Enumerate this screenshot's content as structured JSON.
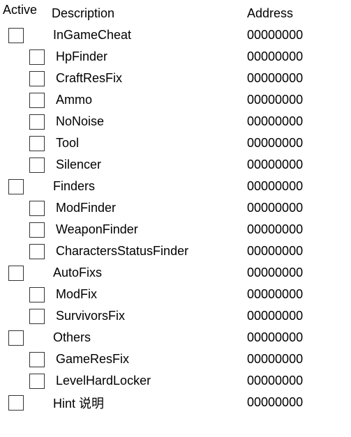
{
  "columns": {
    "active": "Active",
    "description": "Description",
    "address": "Address"
  },
  "rows": [
    {
      "indent": 0,
      "desc": "InGameCheat",
      "addr": "00000000",
      "checked": false
    },
    {
      "indent": 1,
      "desc": "HpFinder",
      "addr": "00000000",
      "checked": false
    },
    {
      "indent": 1,
      "desc": "CraftResFix",
      "addr": "00000000",
      "checked": false
    },
    {
      "indent": 1,
      "desc": "Ammo",
      "addr": "00000000",
      "checked": false
    },
    {
      "indent": 1,
      "desc": "NoNoise",
      "addr": "00000000",
      "checked": false
    },
    {
      "indent": 1,
      "desc": "Tool",
      "addr": "00000000",
      "checked": false
    },
    {
      "indent": 1,
      "desc": "Silencer",
      "addr": "00000000",
      "checked": false
    },
    {
      "indent": 0,
      "desc": "Finders",
      "addr": "00000000",
      "checked": false
    },
    {
      "indent": 1,
      "desc": "ModFinder",
      "addr": "00000000",
      "checked": false
    },
    {
      "indent": 1,
      "desc": "WeaponFinder",
      "addr": "00000000",
      "checked": false
    },
    {
      "indent": 1,
      "desc": "CharactersStatusFinder",
      "addr": "00000000",
      "checked": false
    },
    {
      "indent": 0,
      "desc": "AutoFixs",
      "addr": "00000000",
      "checked": false
    },
    {
      "indent": 1,
      "desc": "ModFix",
      "addr": "00000000",
      "checked": false
    },
    {
      "indent": 1,
      "desc": "SurvivorsFix",
      "addr": "00000000",
      "checked": false
    },
    {
      "indent": 0,
      "desc": "Others",
      "addr": "00000000",
      "checked": false
    },
    {
      "indent": 1,
      "desc": "GameResFix",
      "addr": "00000000",
      "checked": false
    },
    {
      "indent": 1,
      "desc": "LevelHardLocker",
      "addr": "00000000",
      "checked": false
    },
    {
      "indent": 0,
      "desc": "Hint 说明",
      "addr": "00000000",
      "checked": false
    }
  ]
}
